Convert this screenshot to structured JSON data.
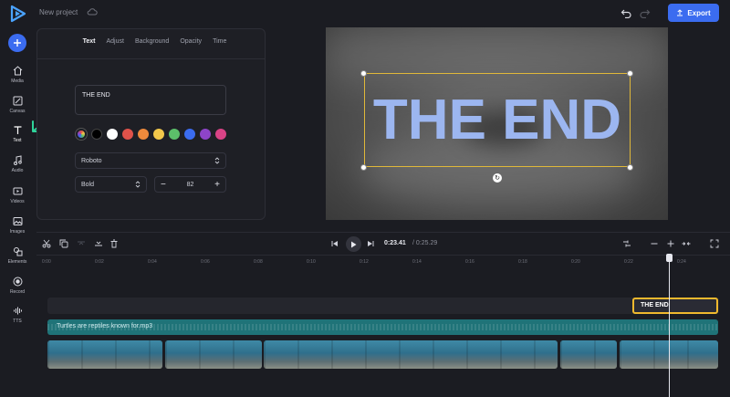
{
  "topbar": {
    "project_title": "New project",
    "export_label": "Export"
  },
  "colors": {
    "accent": "#3b6cf0",
    "selection": "#e0b83a",
    "audio": "#1f7378",
    "text_fill": "#9cb6f0"
  },
  "sidebar": {
    "items": [
      {
        "label": "Media",
        "icon": "media-icon"
      },
      {
        "label": "Canvas",
        "icon": "canvas-icon"
      },
      {
        "label": "Text",
        "icon": "text-icon"
      },
      {
        "label": "Audio",
        "icon": "music-icon"
      },
      {
        "label": "Videos",
        "icon": "video-icon"
      },
      {
        "label": "Images",
        "icon": "image-icon"
      },
      {
        "label": "Elements",
        "icon": "shapes-icon"
      },
      {
        "label": "Record",
        "icon": "record-icon"
      },
      {
        "label": "TTS",
        "icon": "waveform-icon"
      }
    ]
  },
  "panel": {
    "tabs": [
      "Text",
      "Adjust",
      "Background",
      "Opacity",
      "Time"
    ],
    "active_tab": "Text",
    "text_value": "THE END",
    "swatches": [
      "#000000",
      "#ffffff",
      "#e0524a",
      "#ee8a3c",
      "#f2c84b",
      "#5cbf6a",
      "#3b6cf0",
      "#8e44c8",
      "#d94386"
    ],
    "font": "Roboto",
    "weight": "Bold",
    "size": "82"
  },
  "preview": {
    "text": "THE END"
  },
  "timeline": {
    "current_time": "0:23.41",
    "total_time": "/ 0:25.29",
    "ticks": [
      "0:00",
      "0:02",
      "0:04",
      "0:06",
      "0:08",
      "0:10",
      "0:12",
      "0:14",
      "0:16",
      "0:18",
      "0:20",
      "0:22",
      "0:24"
    ],
    "text_clip_label": "THE END",
    "audio_label": "Turtles are reptiles known for.mp3"
  }
}
